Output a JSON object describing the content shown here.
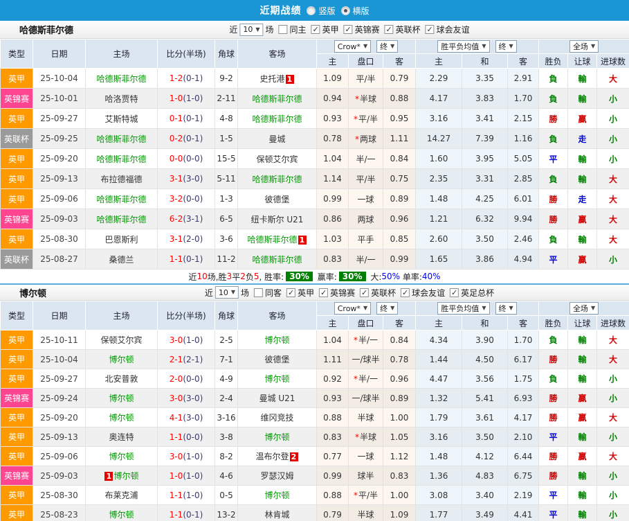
{
  "titlebar": {
    "title": "近期战绩",
    "vertical": "竖版",
    "horizontal": "横版"
  },
  "columns": {
    "type": "类型",
    "date": "日期",
    "home": "主场",
    "score": "比分(半场)",
    "corner": "角球",
    "away": "客场",
    "odds_home": "主",
    "handicap": "盘口",
    "odds_away": "客",
    "avg_home": "主",
    "avg_draw": "和",
    "avg_away": "客",
    "res_wdl": "胜负",
    "res_handicap": "让球",
    "res_goals": "进球数"
  },
  "controls": {
    "bookmaker": "Crow*",
    "final": "终",
    "avg": "胜平负均值",
    "scope": "全场"
  },
  "colors": {
    "topbar": "#1a96d4",
    "type": {
      "英甲": "#ff9900",
      "英锦赛": "#ff4490",
      "英联杯": "#9a9a9a"
    },
    "result": {
      "勝": "#d40000",
      "贏": "#d40000",
      "大": "#d40000",
      "負": "#008000",
      "輸": "#008000",
      "小": "#008000",
      "平": "#0000d4",
      "走": "#0000d4"
    },
    "team_green": "#009900",
    "score_red": "#ff0000",
    "half_navy": "#3a3a6a",
    "summary_box": "#008000",
    "summary_blue": "#0000ee"
  },
  "sections": [
    {
      "team": "哈德斯菲尔德",
      "filters": {
        "near": "近",
        "count": "10",
        "games": "场",
        "same": "同主",
        "same_checked": false,
        "leagues": [
          "英甲",
          "英锦赛",
          "英联杯",
          "球会友谊"
        ]
      },
      "rows": [
        {
          "type": "英甲",
          "date": "25-10-04",
          "home": "哈德斯菲尔德",
          "homeGreen": true,
          "score": "1-2",
          "half": "0-1",
          "corner": "9-2",
          "away": "史托港",
          "awayBadge": "1",
          "o1": "1.09",
          "hcap": "平/半",
          "o2": "0.79",
          "a1": "2.29",
          "a2": "3.35",
          "a3": "2.91",
          "r1": "負",
          "r2": "輸",
          "r3": "大"
        },
        {
          "type": "英锦赛",
          "date": "25-10-01",
          "home": "哈洛贾特",
          "score": "1-0",
          "half": "1-0",
          "corner": "2-11",
          "away": "哈德斯菲尔德",
          "awayGreen": true,
          "o1": "0.94",
          "star": true,
          "hcap": "半球",
          "o2": "0.88",
          "a1": "4.17",
          "a2": "3.83",
          "a3": "1.70",
          "r1": "負",
          "r2": "輸",
          "r3": "小"
        },
        {
          "type": "英甲",
          "date": "25-09-27",
          "home": "艾斯特城",
          "score": "0-1",
          "half": "0-1",
          "corner": "4-8",
          "away": "哈德斯菲尔德",
          "awayGreen": true,
          "o1": "0.93",
          "star": true,
          "hcap": "平/半",
          "o2": "0.95",
          "a1": "3.16",
          "a2": "3.41",
          "a3": "2.15",
          "r1": "勝",
          "r2": "贏",
          "r3": "小"
        },
        {
          "type": "英联杯",
          "date": "25-09-25",
          "home": "哈德斯菲尔德",
          "homeGreen": true,
          "score": "0-2",
          "half": "0-1",
          "corner": "1-5",
          "away": "曼城",
          "o1": "0.78",
          "star": true,
          "hcap": "两球",
          "o2": "1.11",
          "a1": "14.27",
          "a2": "7.39",
          "a3": "1.16",
          "r1": "負",
          "r2": "走",
          "r3": "小"
        },
        {
          "type": "英甲",
          "date": "25-09-20",
          "home": "哈德斯菲尔德",
          "homeGreen": true,
          "score": "0-0",
          "half": "0-0",
          "corner": "15-5",
          "away": "保顿艾尔宾",
          "o1": "1.04",
          "hcap": "半/一",
          "o2": "0.84",
          "a1": "1.60",
          "a2": "3.95",
          "a3": "5.05",
          "r1": "平",
          "r2": "輸",
          "r3": "小"
        },
        {
          "type": "英甲",
          "date": "25-09-13",
          "home": "布拉德福德",
          "score": "3-1",
          "half": "3-0",
          "corner": "5-11",
          "away": "哈德斯菲尔德",
          "awayGreen": true,
          "o1": "1.14",
          "hcap": "平/半",
          "o2": "0.75",
          "a1": "2.35",
          "a2": "3.31",
          "a3": "2.85",
          "r1": "負",
          "r2": "輸",
          "r3": "大"
        },
        {
          "type": "英甲",
          "date": "25-09-06",
          "home": "哈德斯菲尔德",
          "homeGreen": true,
          "score": "3-2",
          "half": "0-0",
          "corner": "1-3",
          "away": "彼德堡",
          "o1": "0.99",
          "hcap": "一球",
          "o2": "0.89",
          "a1": "1.48",
          "a2": "4.25",
          "a3": "6.01",
          "r1": "勝",
          "r2": "走",
          "r3": "大"
        },
        {
          "type": "英锦赛",
          "date": "25-09-03",
          "home": "哈德斯菲尔德",
          "homeGreen": true,
          "score": "6-2",
          "half": "3-1",
          "corner": "6-5",
          "away": "纽卡斯尔 U21",
          "o1": "0.86",
          "hcap": "两球",
          "o2": "0.96",
          "a1": "1.21",
          "a2": "6.32",
          "a3": "9.94",
          "r1": "勝",
          "r2": "贏",
          "r3": "大"
        },
        {
          "type": "英甲",
          "date": "25-08-30",
          "home": "巴恩斯利",
          "score": "3-1",
          "half": "2-0",
          "corner": "3-6",
          "away": "哈德斯菲尔德",
          "awayGreen": true,
          "awayBadge": "1",
          "o1": "1.03",
          "hcap": "平手",
          "o2": "0.85",
          "a1": "2.60",
          "a2": "3.50",
          "a3": "2.46",
          "r1": "負",
          "r2": "輸",
          "r3": "大"
        },
        {
          "type": "英联杯",
          "date": "25-08-27",
          "home": "桑德兰",
          "score": "1-1",
          "half": "0-1",
          "corner": "11-2",
          "away": "哈德斯菲尔德",
          "awayGreen": true,
          "o1": "0.83",
          "hcap": "半/一",
          "o2": "0.99",
          "a1": "1.65",
          "a2": "3.86",
          "a3": "4.94",
          "r1": "平",
          "r2": "贏",
          "r3": "小"
        }
      ],
      "summary": [
        {
          "t": "近"
        },
        {
          "t": "10",
          "s": "red"
        },
        {
          "t": "场,胜"
        },
        {
          "t": "3",
          "s": "red"
        },
        {
          "t": "平"
        },
        {
          "t": "2",
          "s": "red"
        },
        {
          "t": "负"
        },
        {
          "t": "5",
          "s": "red"
        },
        {
          "t": ", 胜率:"
        },
        {
          "t": "30%",
          "s": "box"
        },
        {
          "t": " 赢率:"
        },
        {
          "t": "30%",
          "s": "box"
        },
        {
          "t": " 大:"
        },
        {
          "t": "50%",
          "s": "blue"
        },
        {
          "t": " 单率:"
        },
        {
          "t": "40%",
          "s": "blue"
        }
      ]
    },
    {
      "team": "博尔顿",
      "filters": {
        "near": "近",
        "count": "10",
        "games": "场",
        "same": "同客",
        "same_checked": false,
        "leagues": [
          "英甲",
          "英锦赛",
          "英联杯",
          "球会友谊",
          "英足总杯"
        ]
      },
      "rows": [
        {
          "type": "英甲",
          "date": "25-10-11",
          "home": "保顿艾尔宾",
          "score": "3-0",
          "half": "1-0",
          "corner": "2-5",
          "away": "博尔顿",
          "awayGreen": true,
          "o1": "1.04",
          "star": true,
          "hcap": "半/一",
          "o2": "0.84",
          "a1": "4.34",
          "a2": "3.90",
          "a3": "1.70",
          "r1": "負",
          "r2": "輸",
          "r3": "大"
        },
        {
          "type": "英甲",
          "date": "25-10-04",
          "home": "博尔顿",
          "homeGreen": true,
          "score": "2-1",
          "half": "2-1",
          "corner": "7-1",
          "away": "彼德堡",
          "o1": "1.11",
          "hcap": "一/球半",
          "o2": "0.78",
          "a1": "1.44",
          "a2": "4.50",
          "a3": "6.17",
          "r1": "勝",
          "r2": "輸",
          "r3": "大"
        },
        {
          "type": "英甲",
          "date": "25-09-27",
          "home": "北安普敦",
          "score": "2-0",
          "half": "0-0",
          "corner": "4-9",
          "away": "博尔顿",
          "awayGreen": true,
          "o1": "0.92",
          "star": true,
          "hcap": "半/一",
          "o2": "0.96",
          "a1": "4.47",
          "a2": "3.56",
          "a3": "1.75",
          "r1": "負",
          "r2": "輸",
          "r3": "小"
        },
        {
          "type": "英锦赛",
          "date": "25-09-24",
          "home": "博尔顿",
          "homeGreen": true,
          "score": "3-0",
          "half": "3-0",
          "corner": "2-4",
          "away": "曼城 U21",
          "o1": "0.93",
          "hcap": "一/球半",
          "o2": "0.89",
          "a1": "1.32",
          "a2": "5.41",
          "a3": "6.93",
          "r1": "勝",
          "r2": "贏",
          "r3": "小"
        },
        {
          "type": "英甲",
          "date": "25-09-20",
          "home": "博尔顿",
          "homeGreen": true,
          "score": "4-1",
          "half": "3-0",
          "corner": "3-16",
          "away": "维冈竞技",
          "o1": "0.88",
          "hcap": "半球",
          "o2": "1.00",
          "a1": "1.79",
          "a2": "3.61",
          "a3": "4.17",
          "r1": "勝",
          "r2": "贏",
          "r3": "大"
        },
        {
          "type": "英甲",
          "date": "25-09-13",
          "home": "奥连特",
          "score": "1-1",
          "half": "0-0",
          "corner": "3-8",
          "away": "博尔顿",
          "awayGreen": true,
          "o1": "0.83",
          "star": true,
          "hcap": "半球",
          "o2": "1.05",
          "a1": "3.16",
          "a2": "3.50",
          "a3": "2.10",
          "r1": "平",
          "r2": "輸",
          "r3": "小"
        },
        {
          "type": "英甲",
          "date": "25-09-06",
          "home": "博尔顿",
          "homeGreen": true,
          "score": "3-0",
          "half": "1-0",
          "corner": "8-2",
          "away": "温布尔登",
          "awayBadge": "2",
          "o1": "0.77",
          "hcap": "一球",
          "o2": "1.12",
          "a1": "1.48",
          "a2": "4.12",
          "a3": "6.44",
          "r1": "勝",
          "r2": "贏",
          "r3": "大"
        },
        {
          "type": "英锦赛",
          "date": "25-09-03",
          "home": "博尔顿",
          "homeGreen": true,
          "homeBadge": "1",
          "homeBadgePos": "before",
          "score": "1-0",
          "half": "1-0",
          "corner": "4-6",
          "away": "罗瑟汉姆",
          "o1": "0.99",
          "hcap": "球半",
          "o2": "0.83",
          "a1": "1.36",
          "a2": "4.83",
          "a3": "6.75",
          "r1": "勝",
          "r2": "輸",
          "r3": "小"
        },
        {
          "type": "英甲",
          "date": "25-08-30",
          "home": "布莱克浦",
          "score": "1-1",
          "half": "1-0",
          "corner": "0-5",
          "away": "博尔顿",
          "awayGreen": true,
          "o1": "0.88",
          "star": true,
          "hcap": "平/半",
          "o2": "1.00",
          "a1": "3.08",
          "a2": "3.40",
          "a3": "2.19",
          "r1": "平",
          "r2": "輸",
          "r3": "小"
        },
        {
          "type": "英甲",
          "date": "25-08-23",
          "home": "博尔顿",
          "homeGreen": true,
          "score": "1-1",
          "half": "0-1",
          "corner": "13-2",
          "away": "林肯城",
          "o1": "0.79",
          "hcap": "半球",
          "o2": "1.09",
          "a1": "1.77",
          "a2": "3.49",
          "a3": "4.41",
          "r1": "平",
          "r2": "輸",
          "r3": "小"
        }
      ],
      "summary": []
    }
  ]
}
